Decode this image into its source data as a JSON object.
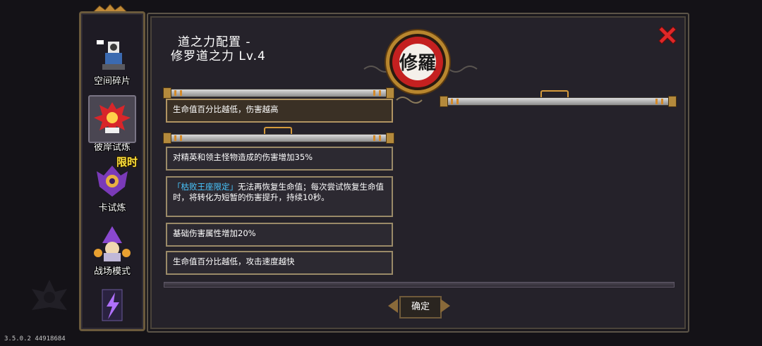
{
  "version": "3.5.0.2 44918684",
  "sidebar": {
    "items": [
      {
        "label": "空间碎片",
        "icon": "space-fragment-icon"
      },
      {
        "label": "彼岸试炼",
        "icon": "red-flower-icon"
      },
      {
        "label": "卡试炼",
        "icon": "purple-crest-icon",
        "badge": "限时"
      },
      {
        "label": "战场模式",
        "icon": "purple-mage-icon"
      },
      {
        "label": "",
        "icon": "lightning-card-icon"
      }
    ]
  },
  "panel": {
    "title_line1": "道之力配置 -",
    "title_line2": "修罗道之力 Lv.4",
    "medallion_text": "修羅",
    "cards": [
      {
        "text": "生命值百分比越低，伤害越高"
      },
      {
        "text": "对精英和领主怪物造成的伤害增加35%"
      },
      {
        "highlight": "「枯败王座限定」",
        "text": "无法再恢复生命值；每次尝试恢复生命值时，将转化为短暂的伤害提升，持续10秒。"
      },
      {
        "text": "基础伤害属性增加20%"
      },
      {
        "text": "生命值百分比越低，攻击速度越快"
      }
    ],
    "confirm_label": "确定"
  },
  "colors": {
    "accent": "#b02020",
    "highlight": "#49c7ff",
    "gold": "#d49a3c"
  }
}
